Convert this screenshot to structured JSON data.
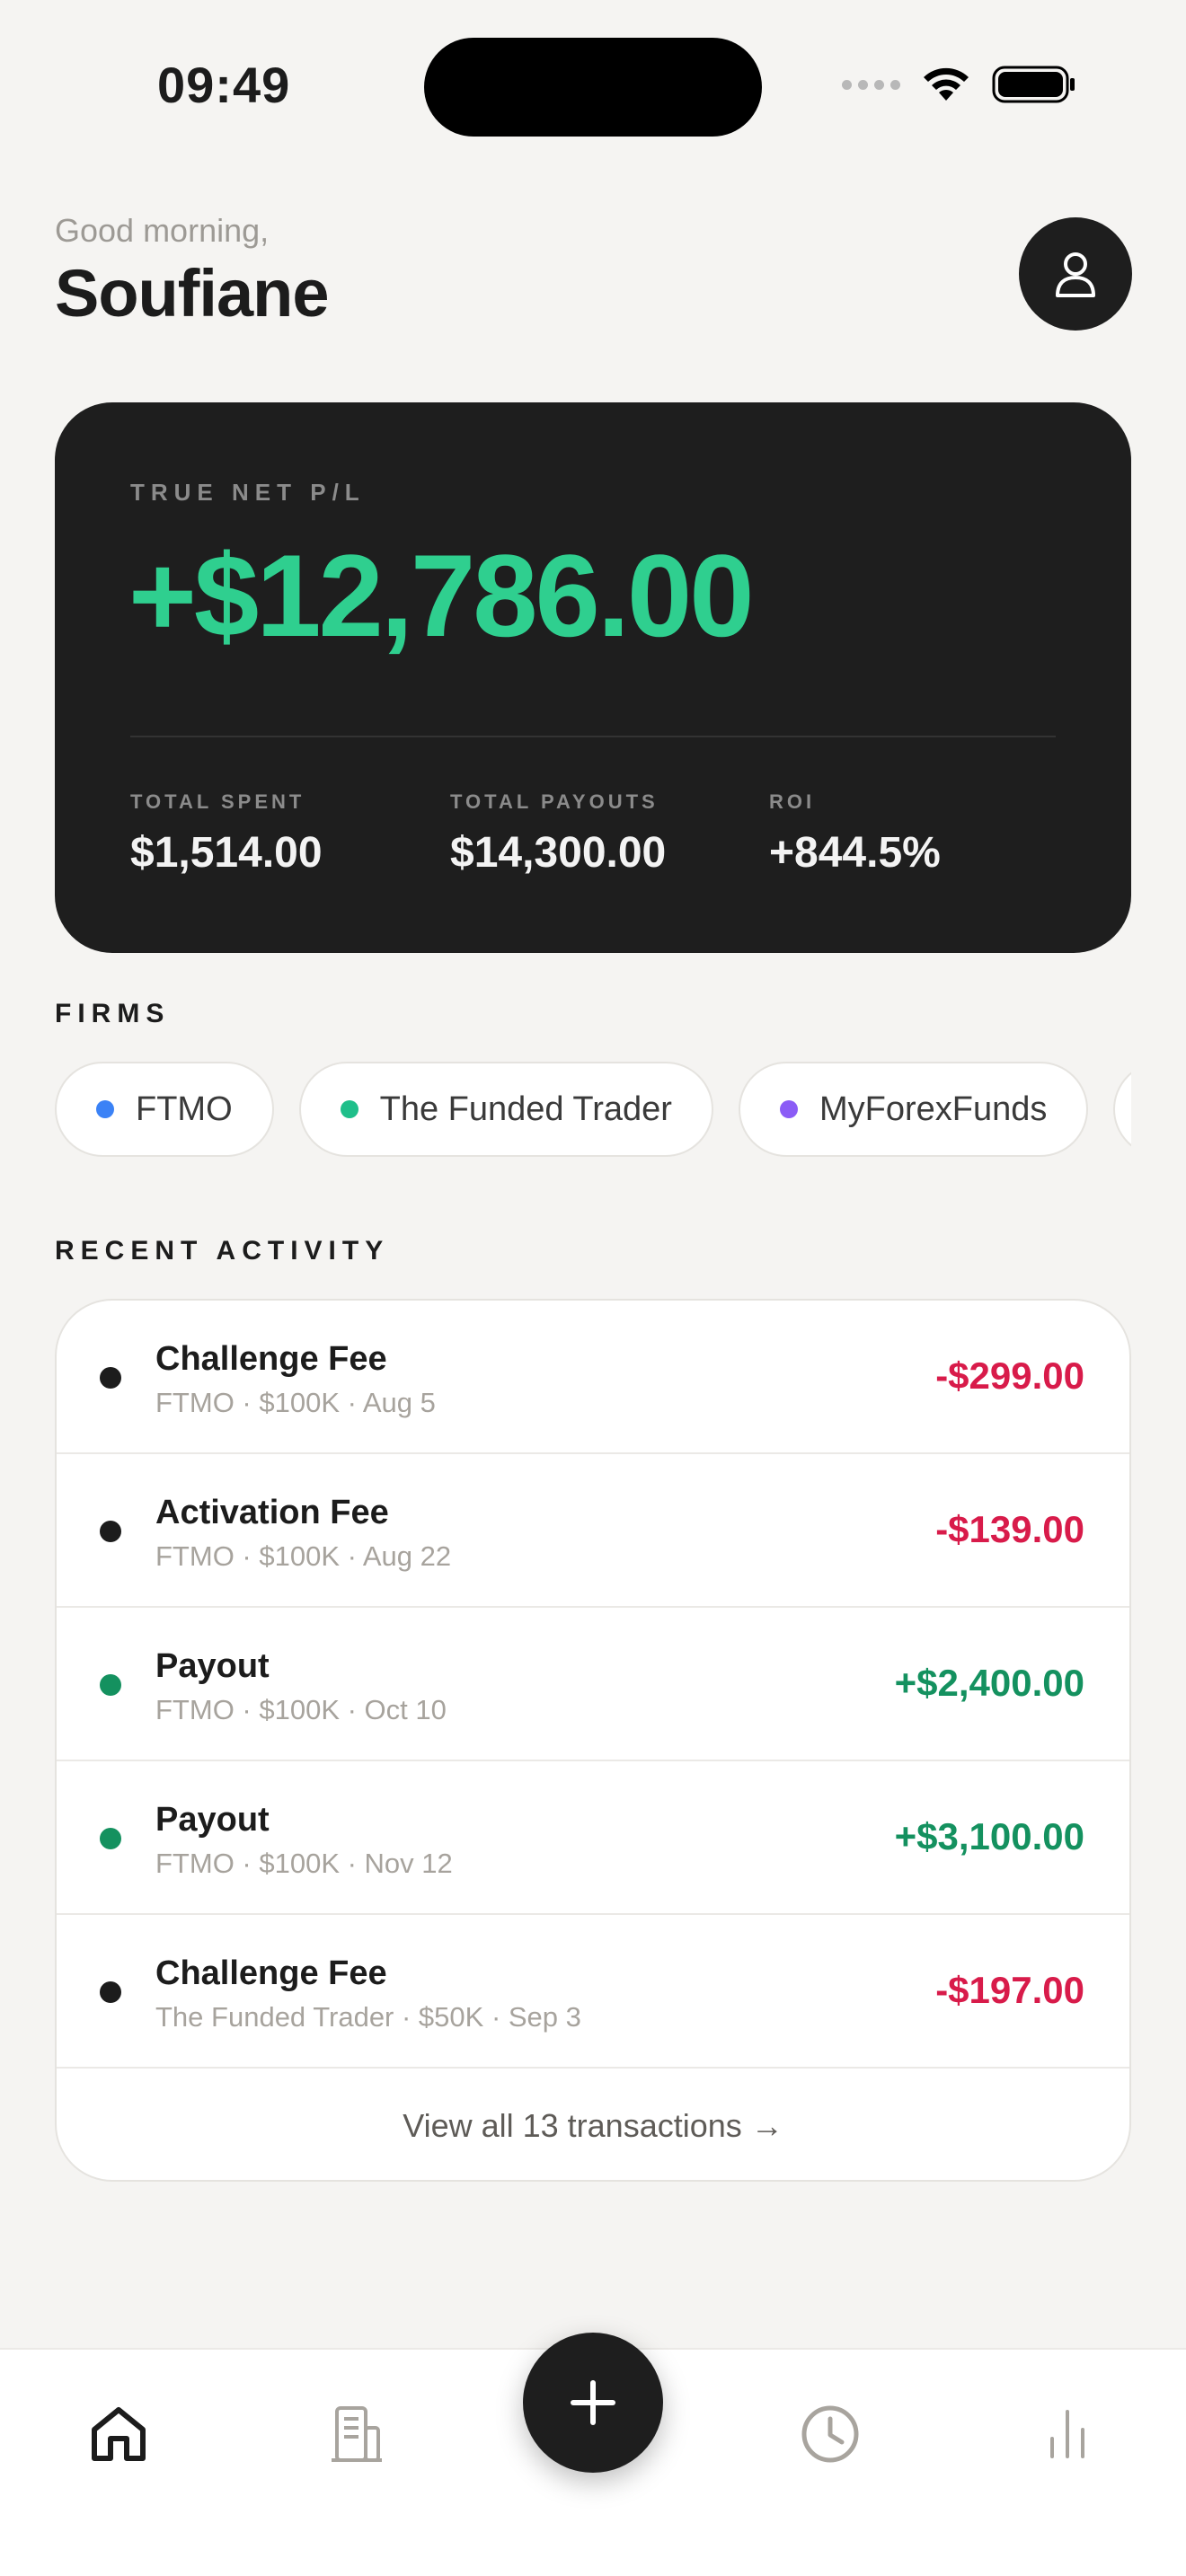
{
  "status_bar": {
    "time": "09:49"
  },
  "header": {
    "greeting": "Good morning,",
    "name": "Soufiane"
  },
  "summary": {
    "label": "TRUE NET P/L",
    "net_value": "+$12,786.00",
    "accent_color": "#2fcf8f",
    "stats": [
      {
        "label": "TOTAL SPENT",
        "value": "$1,514.00"
      },
      {
        "label": "TOTAL PAYOUTS",
        "value": "$14,300.00"
      },
      {
        "label": "ROI",
        "value": "+844.5%"
      }
    ]
  },
  "firms": {
    "title": "FIRMS",
    "items": [
      {
        "name": "FTMO",
        "color": "#3b82f6"
      },
      {
        "name": "The Funded Trader",
        "color": "#1fbf8a"
      },
      {
        "name": "MyForexFunds",
        "color": "#8b5cf6"
      },
      {
        "name": "",
        "color": "#f59e0b"
      }
    ]
  },
  "activity": {
    "title": "RECENT ACTIVITY",
    "transactions": [
      {
        "title": "Challenge Fee",
        "subtitle": "FTMO · $100K · Aug 5",
        "amount": "-$299.00",
        "kind": "expense"
      },
      {
        "title": "Activation Fee",
        "subtitle": "FTMO · $100K · Aug 22",
        "amount": "-$139.00",
        "kind": "expense"
      },
      {
        "title": "Payout",
        "subtitle": "FTMO · $100K · Oct 10",
        "amount": "+$2,400.00",
        "kind": "income"
      },
      {
        "title": "Payout",
        "subtitle": "FTMO · $100K · Nov 12",
        "amount": "+$3,100.00",
        "kind": "income"
      },
      {
        "title": "Challenge Fee",
        "subtitle": "The Funded Trader · $50K · Sep 3",
        "amount": "-$197.00",
        "kind": "expense"
      }
    ],
    "view_all_label": "View all 13 transactions →"
  },
  "colors": {
    "expense": "#d81b4a",
    "income": "#14915f",
    "expense_dot": "#1c1c1c",
    "income_dot": "#14915f"
  },
  "tabbar": {
    "icons": [
      "home-icon",
      "building-icon",
      "plus-icon",
      "clock-icon",
      "bar-chart-icon"
    ]
  }
}
